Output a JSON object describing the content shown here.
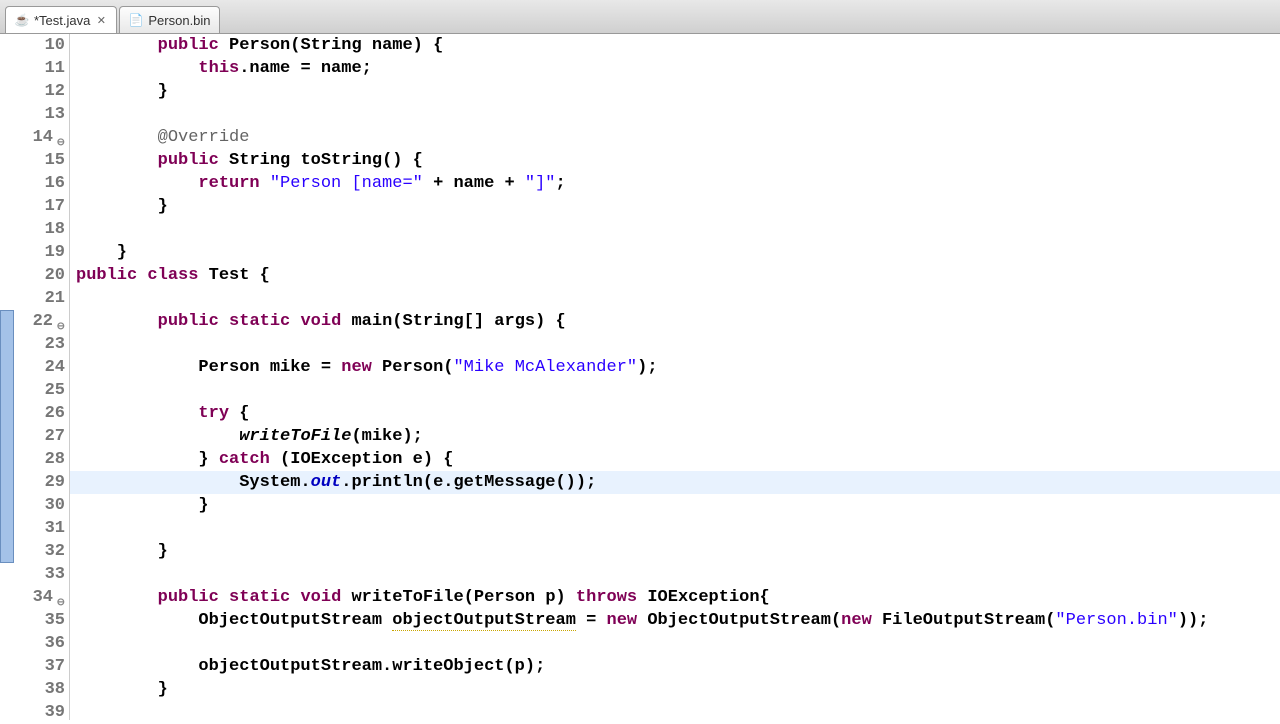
{
  "tabs": {
    "active": {
      "label": "*Test.java",
      "icon_name": "java-file-icon"
    },
    "other": {
      "label": "Person.bin",
      "icon_name": "binary-file-icon"
    }
  },
  "gutter": {
    "start": 10,
    "end": 39
  },
  "code": {
    "l10": {
      "t1": "public",
      "t2": " Person(String name) {"
    },
    "l11": {
      "t1": "this",
      "t2": ".name = name;"
    },
    "l12": {
      "t1": "        }"
    },
    "l13": {
      "t1": ""
    },
    "l14": {
      "t1": "        ",
      "ann": "@Override"
    },
    "l15": {
      "t1": "public",
      "t2": " String toString() {"
    },
    "l16": {
      "t1": "return",
      "t2": " ",
      "s1": "\"Person [name=\"",
      "t3": " + name + ",
      "s2": "\"]\"",
      "t4": ";"
    },
    "l17": {
      "t1": "        }"
    },
    "l18": {
      "t1": ""
    },
    "l19": {
      "t1": "    }"
    },
    "l20": {
      "k1": "public",
      "k2": "class",
      "t1": " Test {"
    },
    "l21": {
      "t1": ""
    },
    "l22": {
      "k1": "public",
      "k2": "static",
      "k3": "void",
      "t1": " main(String[] args) {"
    },
    "l23": {
      "t1": ""
    },
    "l24": {
      "t1": "            Person mike = ",
      "k1": "new",
      "t2": " Person(",
      "s1": "\"Mike McAlexander\"",
      "t3": ");"
    },
    "l25": {
      "t1": ""
    },
    "l26": {
      "t1": "            ",
      "k1": "try",
      "t2": " {"
    },
    "l27": {
      "t1": "                ",
      "m1": "writeToFile",
      "t2": "(mike);"
    },
    "l28": {
      "t1": "            } ",
      "k1": "catch",
      "t2": " (IOException e) {"
    },
    "l29": {
      "t1": "                System.",
      "sf": "out",
      "t2": ".println(e.getMessage());"
    },
    "l30": {
      "t1": "            }"
    },
    "l31": {
      "t1": ""
    },
    "l32": {
      "t1": "        }"
    },
    "l33": {
      "t1": ""
    },
    "l34": {
      "k1": "public",
      "k2": "static",
      "k3": "void",
      "t1": " writeToFile(Person p) ",
      "k4": "throws",
      "t2": " IOException{"
    },
    "l35": {
      "t1": "            ObjectOutputStream ",
      "var": "objectOutputStream",
      "t2": " = ",
      "k1": "new",
      "t3": " ObjectOutputStream(",
      "k2": "new",
      "t4": " FileOutputStream(",
      "s1": "\"Person.bin\"",
      "t5": "));"
    },
    "l36": {
      "t1": ""
    },
    "l37": {
      "t1": "            objectOutputStream.writeObject(p);"
    },
    "l38": {
      "t1": "        }"
    },
    "l39": {
      "t1": ""
    }
  },
  "highlight_line": 29,
  "change_range": {
    "from": 22,
    "to": 32
  }
}
